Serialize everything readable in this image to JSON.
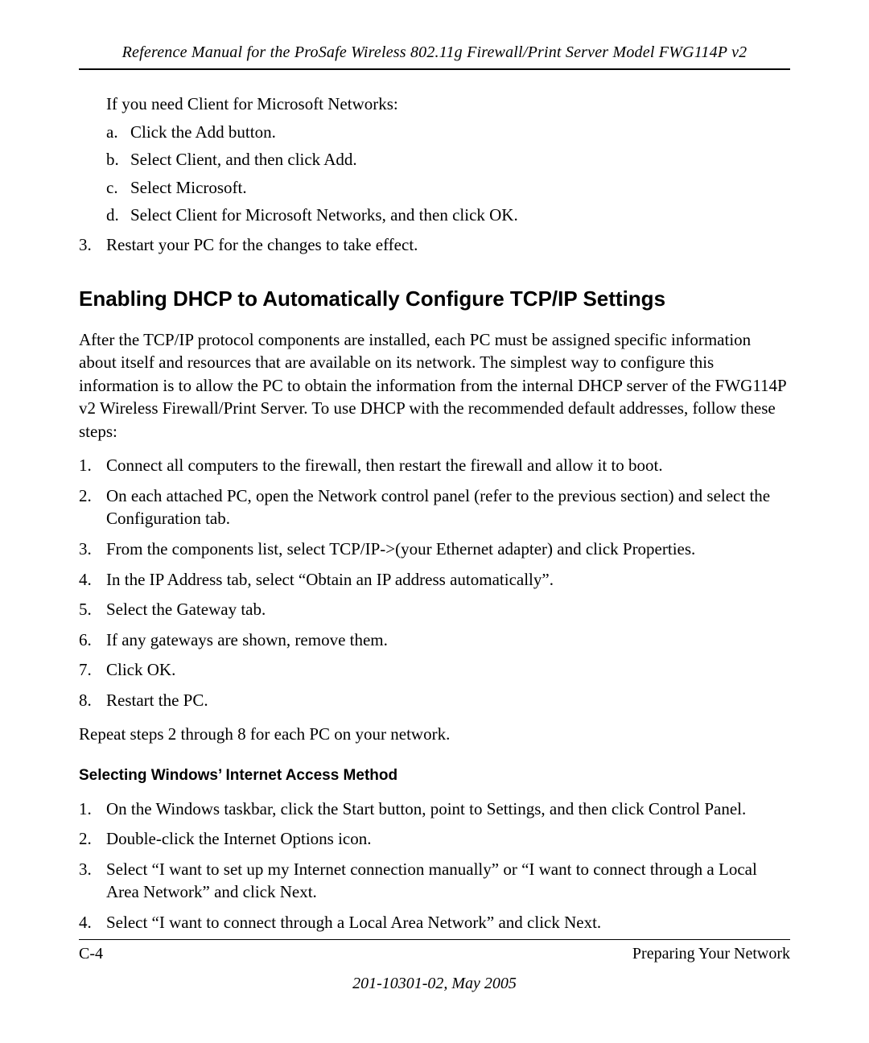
{
  "header": {
    "title": "Reference Manual for the ProSafe Wireless 802.11g  Firewall/Print Server Model FWG114P v2"
  },
  "section1": {
    "intro_indented": "If you need Client for Microsoft Networks:",
    "sublist": [
      {
        "marker": "a.",
        "text": "Click the Add button."
      },
      {
        "marker": "b.",
        "text": "Select Client, and then click Add."
      },
      {
        "marker": "c.",
        "text": "Select Microsoft."
      },
      {
        "marker": "d.",
        "text": "Select Client for Microsoft Networks, and then click OK."
      }
    ],
    "outer_item": {
      "marker": "3.",
      "text": "Restart your PC for the changes to take effect."
    }
  },
  "section2": {
    "heading": "Enabling DHCP to Automatically Configure TCP/IP Settings",
    "paragraph": "After the TCP/IP protocol components are installed, each PC must be assigned specific information about itself and resources that are available on its network. The simplest way to configure this information is to allow the PC to obtain the information from the internal DHCP server of the FWG114P v2 Wireless Firewall/Print Server. To use DHCP with the recommended default addresses, follow these steps:",
    "items": [
      {
        "marker": "1.",
        "text": "Connect all computers to the firewall, then restart the firewall and allow it to boot."
      },
      {
        "marker": "2.",
        "text": "On each attached PC, open the Network control panel (refer to the previous section) and select the Configuration tab."
      },
      {
        "marker": "3.",
        "text": "From the components list, select TCP/IP->(your Ethernet adapter) and click Properties."
      },
      {
        "marker": "4.",
        "text": "In the IP Address tab, select “Obtain an IP address automatically”."
      },
      {
        "marker": "5.",
        "text": "Select the Gateway tab."
      },
      {
        "marker": "6.",
        "text": "If any gateways are shown, remove them."
      },
      {
        "marker": "7.",
        "text": "Click OK."
      },
      {
        "marker": "8.",
        "text": "Restart the PC."
      }
    ],
    "closing": "Repeat steps 2 through 8 for each PC on your network."
  },
  "section3": {
    "heading": "Selecting Windows’ Internet Access Method",
    "items": [
      {
        "marker": "1.",
        "text": "On the Windows taskbar, click the Start button, point to Settings, and then click Control Panel."
      },
      {
        "marker": "2.",
        "text": "Double-click the Internet Options icon."
      },
      {
        "marker": "3.",
        "text": "Select “I want to set up my Internet connection manually” or “I want to connect through a Local Area Network” and click Next."
      },
      {
        "marker": "4.",
        "text": "Select “I want to connect through a Local Area Network” and click Next."
      }
    ]
  },
  "footer": {
    "page_num": "C-4",
    "section_name": "Preparing Your Network",
    "doc_id": "201-10301-02, May 2005"
  }
}
